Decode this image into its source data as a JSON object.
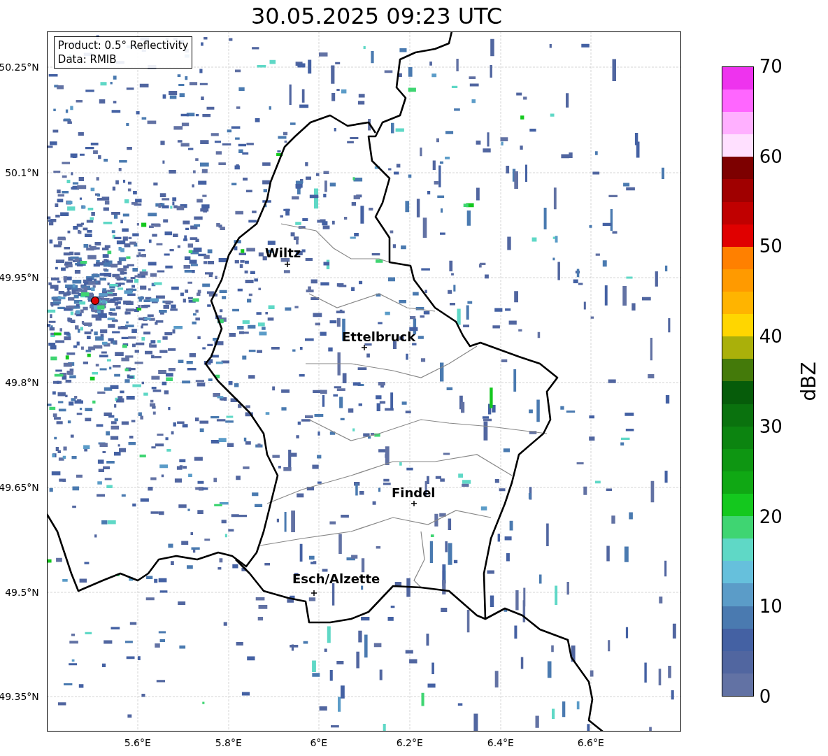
{
  "title": "30.05.2025 09:23 UTC",
  "legend": {
    "lines": [
      "Product: 0.5° Reflectivity",
      "Data: RMIB"
    ]
  },
  "y_ticks": [
    "50.25°N",
    "50.1°N",
    "49.95°N",
    "49.8°N",
    "49.65°N",
    "49.5°N",
    "49.35°N"
  ],
  "x_ticks": [
    "5.6°E",
    "5.8°E",
    "6°E",
    "6.2°E",
    "6.4°E",
    "6.6°E"
  ],
  "places": [
    {
      "name": "Wiltz"
    },
    {
      "name": "Ettelbruck"
    },
    {
      "name": "Findel"
    },
    {
      "name": "Esch/Alzette"
    }
  ],
  "colorbar": {
    "label": "dBZ",
    "ticks": [
      "70",
      "60",
      "50",
      "40",
      "30",
      "20",
      "10",
      "0"
    ],
    "segments": [
      {
        "color": "#6272a4"
      },
      {
        "color": "#5166a0"
      },
      {
        "color": "#4461a3"
      },
      {
        "color": "#4a7ab0"
      },
      {
        "color": "#5b9cc8"
      },
      {
        "color": "#66c0dc"
      },
      {
        "color": "#5fd8c6"
      },
      {
        "color": "#3fd572"
      },
      {
        "color": "#14c81e"
      },
      {
        "color": "#10a814"
      },
      {
        "color": "#0e9612"
      },
      {
        "color": "#0c8410"
      },
      {
        "color": "#0a720e"
      },
      {
        "color": "#065c0a"
      },
      {
        "color": "#447a0a"
      },
      {
        "color": "#aab00a"
      },
      {
        "color": "#ffd600"
      },
      {
        "color": "#ffb400"
      },
      {
        "color": "#ff9a00"
      },
      {
        "color": "#ff8000"
      },
      {
        "color": "#e00000"
      },
      {
        "color": "#c00000"
      },
      {
        "color": "#a00000"
      },
      {
        "color": "#7d0000"
      },
      {
        "color": "#ffe0ff"
      },
      {
        "color": "#ffb0ff"
      },
      {
        "color": "#ff66ff"
      },
      {
        "color": "#ee33ee"
      }
    ]
  }
}
